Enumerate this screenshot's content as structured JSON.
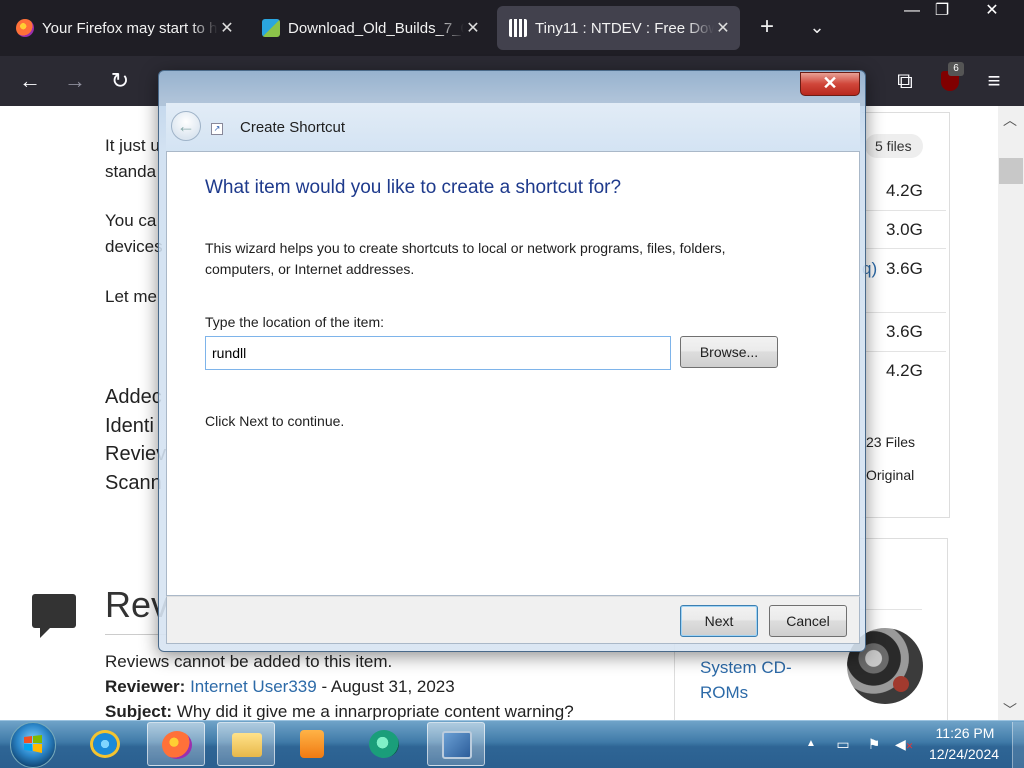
{
  "browser": {
    "tabs": [
      {
        "title": "Your Firefox may start to h",
        "close": "✕"
      },
      {
        "title": "Download_Old_Builds_7_0",
        "close": "✕"
      },
      {
        "title": "Tiny11 : NTDEV : Free Dow",
        "close": "✕"
      }
    ],
    "new_tab": "+",
    "tab_list": "⌄",
    "window_controls": {
      "minimize": "—",
      "maximize": "❐",
      "close": "✕"
    },
    "nav": {
      "back": "←",
      "forward": "→",
      "reload": "↻",
      "extensions": "⧉",
      "menu": "≡"
    },
    "ublock_badge": "6"
  },
  "page": {
    "text_lines": [
      "It just u",
      "standa",
      "You ca",
      "devices",
      "Let me",
      "Addec",
      "Identi",
      "Reviev",
      "Scann"
    ],
    "review_heading": "Rev",
    "reviews_note": "Reviews cannot be added to this item.",
    "reviewer_label": "Reviewer:",
    "reviewer_name": "Internet User339",
    "reviewer_date": "- August 31, 2023",
    "subject_label": "Subject:",
    "subject_text": "Why did it give me a innarpropriate content warning?",
    "side": {
      "files_pill": "5 files",
      "sizes": [
        "4.2G",
        "3.0G",
        "3.6G",
        "3.6G",
        "4.2G"
      ],
      "q_frag": "q)",
      "files_count": "23 Files",
      "original": "Original"
    },
    "card_link": "System CD-ROMs"
  },
  "dialog": {
    "close": "✕",
    "title": "Create Shortcut",
    "question": "What item would you like to create a shortcut for?",
    "description": "This wizard helps you to create shortcuts to local or network programs, files, folders, computers, or Internet addresses.",
    "location_label": "Type the location of the item:",
    "location_value": "rundll",
    "browse_label": "Browse...",
    "hint": "Click Next to continue.",
    "next_label": "Next",
    "cancel_label": "Cancel"
  },
  "taskbar": {
    "time": "11:26 PM",
    "date": "12/24/2024",
    "tray_arrow": "▲"
  },
  "colors": {
    "dialog_question": "#1e3a8c",
    "link": "#2c6aa8",
    "browser_tabbar": "#1f1e25",
    "browser_navbar": "#2b2a33",
    "close_red": "#c7362b"
  }
}
